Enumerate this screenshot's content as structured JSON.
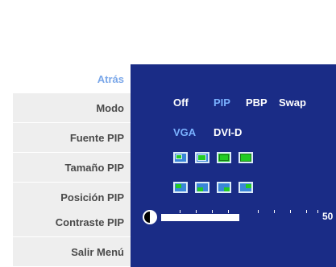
{
  "menu": {
    "items": [
      {
        "label": "Atrás",
        "active": true
      },
      {
        "label": "Modo"
      },
      {
        "label": "Fuente PIP"
      },
      {
        "label": "Tamaño PIP"
      },
      {
        "label": "Posición PIP"
      },
      {
        "label": "Contraste PIP"
      },
      {
        "label": "Salir Menú"
      }
    ]
  },
  "modo": {
    "options": [
      "Off",
      "PIP",
      "PBP",
      "Swap"
    ],
    "selected": "PIP"
  },
  "fuente": {
    "options": [
      "VGA",
      "DVI-D"
    ],
    "selected": "VGA"
  },
  "tamano": {
    "icons": [
      "pip-size-small-icon",
      "pip-size-medium-icon",
      "pip-size-large-icon",
      "pip-size-xlarge-icon"
    ]
  },
  "posicion": {
    "icons": [
      "pip-position-top-left-icon",
      "pip-position-bottom-left-icon",
      "pip-position-bottom-right-icon",
      "pip-position-top-right-icon"
    ]
  },
  "contraste": {
    "value": "50",
    "level_percent": 50,
    "icon": "contrast-icon"
  },
  "colors": {
    "panel": "#1a2c86",
    "selected_option": "#7ab1ff",
    "active_menu_text": "#7aa7e9",
    "icon_border": "#dcecf8",
    "icon_green": "#22cc22",
    "icon_blue": "#3a86d8"
  }
}
